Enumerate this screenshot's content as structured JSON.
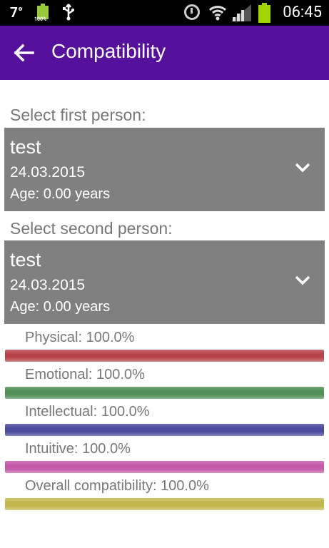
{
  "status_bar": {
    "temperature": "7°",
    "battery_small_label": "100%",
    "time": "06:45"
  },
  "app_bar": {
    "title": "Compatibility"
  },
  "first_person": {
    "label": "Select first person:",
    "name": "test",
    "date": "24.03.2015",
    "age": "Age: 0.00 years"
  },
  "second_person": {
    "label": "Select second person:",
    "name": "test",
    "date": "24.03.2015",
    "age": "Age: 0.00 years"
  },
  "metrics": [
    {
      "label": "Physical: 100.0%",
      "value": 1.0,
      "color": "#b7434a"
    },
    {
      "label": "Emotional: 100.0%",
      "value": 1.0,
      "color": "#4f8f55"
    },
    {
      "label": "Intellectual: 100.0%",
      "value": 1.0,
      "color": "#4a4a9c"
    },
    {
      "label": "Intuitive: 100.0%",
      "value": 1.0,
      "color": "#c45aa8"
    },
    {
      "label": "Overall compatibility: 100.0%",
      "value": 1.0,
      "color": "#c4b74e"
    }
  ]
}
